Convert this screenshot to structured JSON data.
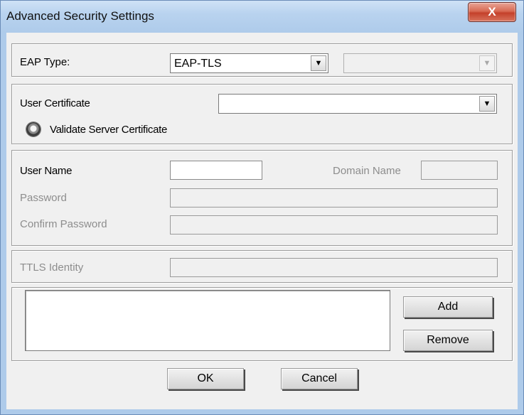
{
  "window": {
    "title": "Advanced Security Settings",
    "close_label": "X"
  },
  "eap": {
    "label": "EAP Type:",
    "value": "EAP-TLS",
    "secondary_value": ""
  },
  "certificate": {
    "label": "User Certificate",
    "value": "",
    "validate_label": "Validate Server Certificate"
  },
  "credentials": {
    "username_label": "User Name",
    "username_value": "",
    "domain_label": "Domain Name",
    "domain_value": "",
    "password_label": "Password",
    "password_value": "",
    "confirm_label": "Confirm Password",
    "confirm_value": ""
  },
  "ttls": {
    "label": "TTLS Identity",
    "value": ""
  },
  "list": {
    "add_label": "Add",
    "remove_label": "Remove"
  },
  "footer": {
    "ok_label": "OK",
    "cancel_label": "Cancel"
  },
  "icons": {
    "dropdown": "chevron-down-icon",
    "close": "close-icon"
  },
  "colors": {
    "title_bar": "#b9d3ef",
    "close_button": "#c4412b",
    "dialog_bg": "#f0f0f0"
  }
}
